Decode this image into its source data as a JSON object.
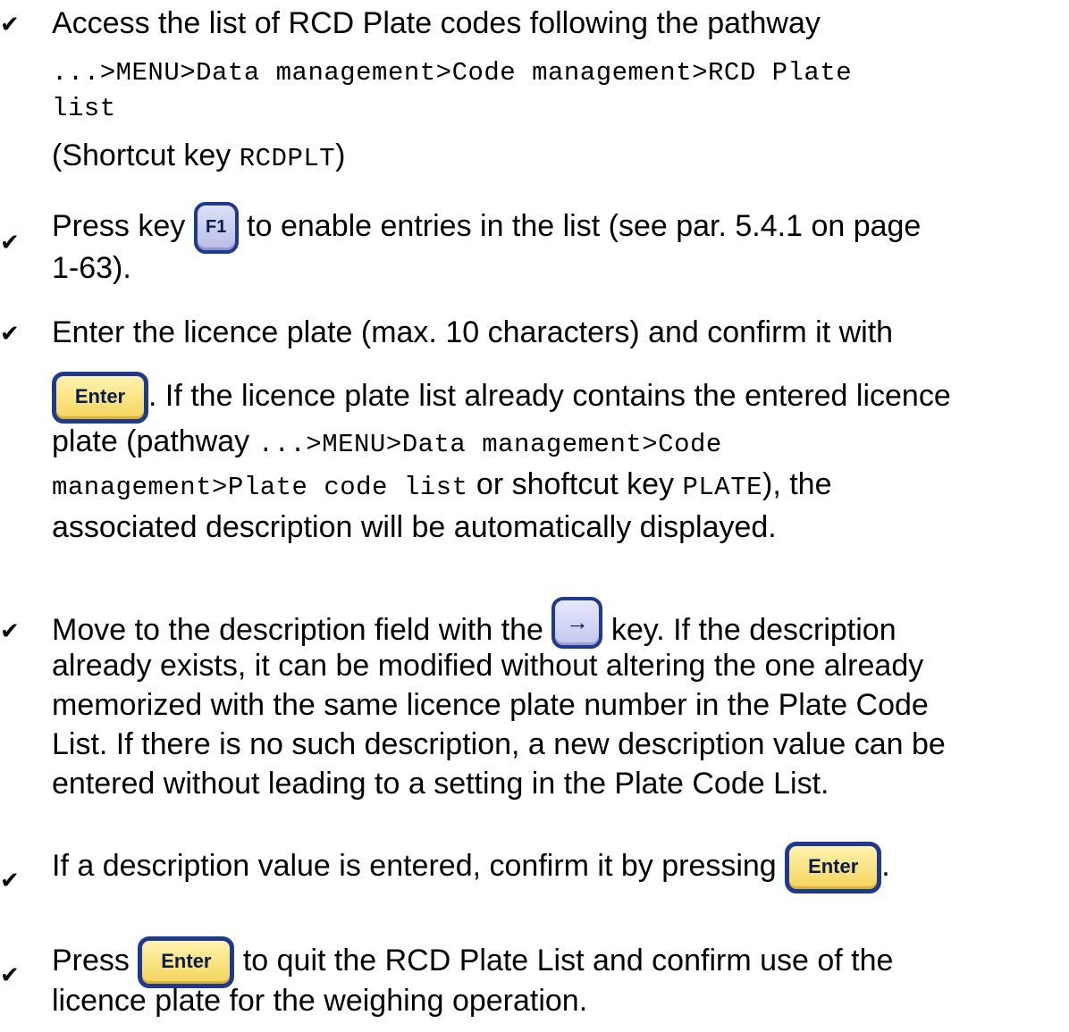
{
  "bullet_symbol": "✔",
  "keys": {
    "f1": "F1",
    "enter": "Enter",
    "arrow_right": "→"
  },
  "item1": {
    "line1": "Access the list of RCD Plate codes following the pathway",
    "path_line1": "...>MENU>Data management>Code management>RCD Plate",
    "path_line2": "list",
    "shortcut_prefix": "(Shortcut key ",
    "shortcut_key": "RCDPLT",
    "shortcut_suffix": ")"
  },
  "item2": {
    "press": "Press key",
    "after_key": " to enable entries in the list (see  par. 5.4.1 on page",
    "line2": "1-63)."
  },
  "item3": {
    "line1": "Enter the licence plate (max. 10 characters) and confirm it with",
    "after_key": ". If the licence plate list already contains the entered licence",
    "plate_prefix": "plate (pathway ",
    "path_part1": "...>MENU>Data management>Code",
    "path_part2": "management>Plate code list",
    "or_text": " or shoftcut key ",
    "shortcut_key": "PLATE",
    "after_shortcut": "), the",
    "line_last": "associated description will be automatically displayed."
  },
  "item4": {
    "before_key": "Move to the description field with the",
    "after_key": " key. If the description",
    "line2": "already exists, it can be modified without altering the one already",
    "line3": "memorized with the same licence plate number in the Plate Code",
    "line4": "List. If there is no such description, a new description value can be",
    "line5": "entered without leading to a setting in the Plate Code List."
  },
  "item5": {
    "before_key": "If a description value is entered, confirm it by pressing",
    "after_key": "."
  },
  "item6": {
    "press": "Press",
    "after_key": " to quit the RCD Plate List and confirm use of the",
    "line2": "licence plate for the weighing operation."
  }
}
